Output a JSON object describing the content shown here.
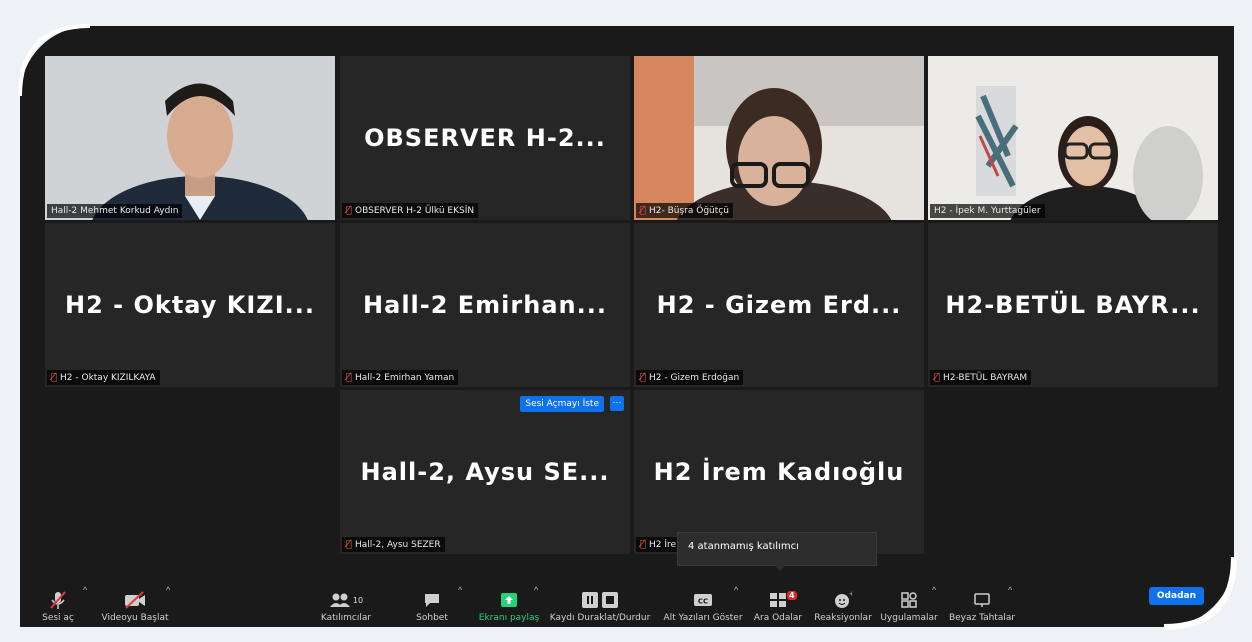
{
  "tiles": [
    {
      "name": "Hall-2 Mehmet Korkud Aydın",
      "video": true,
      "muted": false
    },
    {
      "big": "OBSERVER  H-2...",
      "name": "OBSERVER H-2 Ülkü EKSİN",
      "muted": true
    },
    {
      "name": "H2- Büşra Öğütçü",
      "video": true,
      "muted": true
    },
    {
      "name": "H2 - İpek M. Yurttagüler",
      "video": true,
      "muted": false,
      "active": true
    },
    {
      "big": "H2  -  Oktay  KIZI...",
      "name": "H2 - Oktay KIZILKAYA",
      "muted": true
    },
    {
      "big": "Hall-2  Emirhan...",
      "name": "Hall-2 Emirhan Yaman",
      "muted": true
    },
    {
      "big": "H2  -  Gizem  Erd...",
      "name": "H2 - Gizem Erdoğan",
      "muted": true
    },
    {
      "big": "H2-BETÜL  BAYR...",
      "name": "H2-BETÜL BAYRAM",
      "muted": true
    },
    {
      "big": "Hall-2,  Aysu  SE...",
      "name": "Hall-2, Aysu SEZER",
      "muted": true
    },
    {
      "big": "H2  İrem  Kadıoğlu",
      "name": "H2 İre",
      "muted": true
    }
  ],
  "overlay": {
    "ask_unmute": "Sesi Açmayı İste",
    "more": "···"
  },
  "tooltip": "4 atanmamış katılımcı",
  "toolbar": {
    "unmute": "Sesi aç",
    "start_video": "Videoyu Başlat",
    "participants": "Katılımcılar",
    "participants_count": "10",
    "chat": "Sohbet",
    "share_screen": "Ekranı paylaş",
    "record": "Kaydı Duraklat/Durdur",
    "captions": "Alt Yazıları Göster",
    "breakout": "Ara Odalar",
    "breakout_badge": "4",
    "reactions": "Reaksiyonlar",
    "apps": "Uygulamalar",
    "whiteboard": "Beyaz Tahtalar",
    "leave": "Odadan"
  },
  "colors": {
    "accent": "#0e72ed",
    "active_border": "#c8e36a",
    "share_green": "#26d07c",
    "badge_red": "#e02828"
  }
}
